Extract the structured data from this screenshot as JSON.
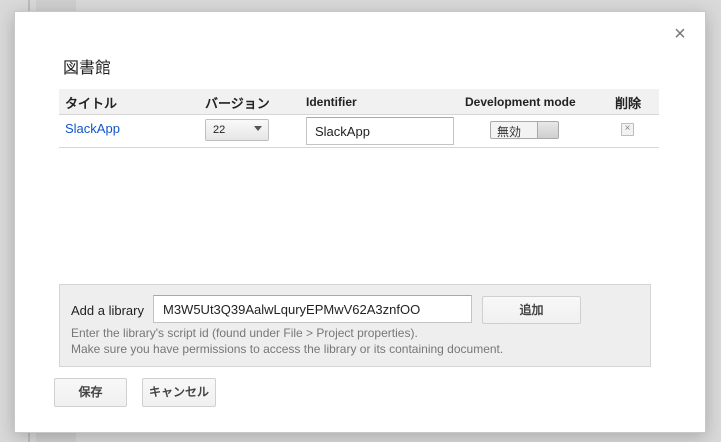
{
  "dialog": {
    "title": "図書館",
    "close_glyph": "×"
  },
  "table": {
    "headers": {
      "title": "タイトル",
      "version": "バージョン",
      "identifier": "Identifier",
      "dev_mode": "Development mode",
      "delete": "削除"
    },
    "rows": [
      {
        "title": "SlackApp",
        "version": "22",
        "identifier": "SlackApp",
        "dev_mode": "無効",
        "delete_glyph": "×"
      }
    ]
  },
  "add_library": {
    "label": "Add a library",
    "value": "M3W5Ut3Q39AalwLquryEPMwV62A3znfOO",
    "button": "追加",
    "help_line1": "Enter the library's script id (found under File > Project properties).",
    "help_line2": "Make sure you have permissions to access the library or its containing document."
  },
  "footer": {
    "save": "保存",
    "cancel": "キャンセル"
  },
  "icons": {
    "close": "close-icon",
    "dropdown": "chevron-down-icon",
    "delete": "close-icon"
  },
  "colors": {
    "link": "#1155cc",
    "header_bg": "#f1f1f1",
    "panel_bg": "#eeeeee"
  }
}
